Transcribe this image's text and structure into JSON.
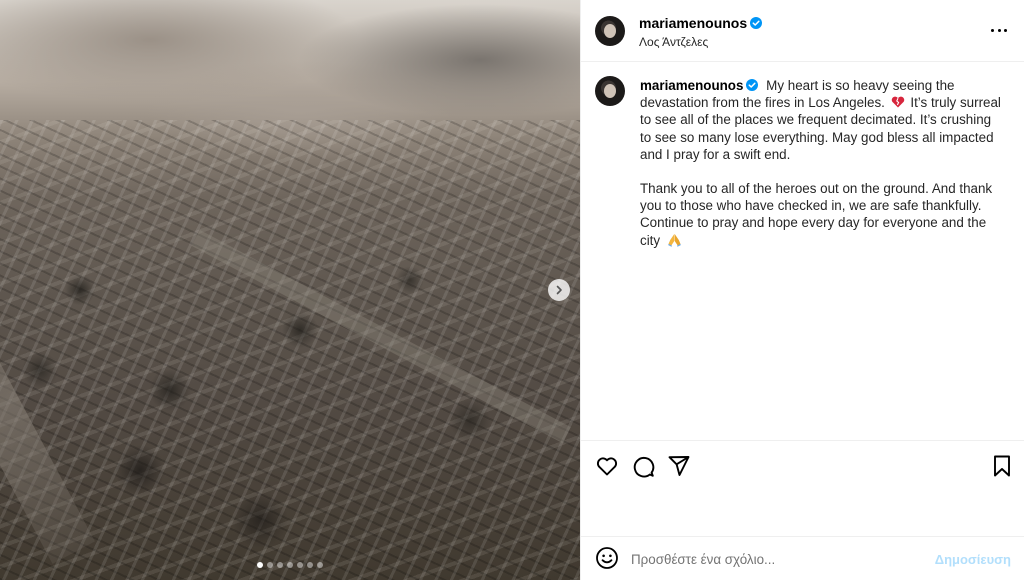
{
  "post": {
    "username": "mariamenounos",
    "location": "Λος Άντζελες",
    "caption_p1_a": "My heart is so heavy seeing the devastation from the fires in Los Angeles.",
    "caption_p1_b": "It’s truly surreal to see all of the places we frequent decimated. It’s crushing to see so many lose everything. May god bless all impacted and I pray for a swift end.",
    "caption_p2": "Thank you to all of the heroes out on the ground. And thank you to those who have checked in, we are safe thankfully. Continue to pray and hope every day for everyone and the city",
    "media": {
      "current_slide": 1,
      "total_slides": 7
    }
  },
  "comment": {
    "placeholder": "Προσθέστε ένα σχόλιο...",
    "post_label": "Δημοσίευση"
  },
  "icons": {
    "verified": "verified-badge-icon",
    "more": "more-options-icon",
    "like": "heart-icon",
    "comment": "comment-icon",
    "share": "share-icon",
    "save": "bookmark-icon",
    "emoji": "emoji-icon",
    "next": "chevron-right-icon"
  },
  "colors": {
    "verified": "#0095f6",
    "post_button_disabled": "#b2dffc",
    "broken_heart": "#d7263d"
  }
}
